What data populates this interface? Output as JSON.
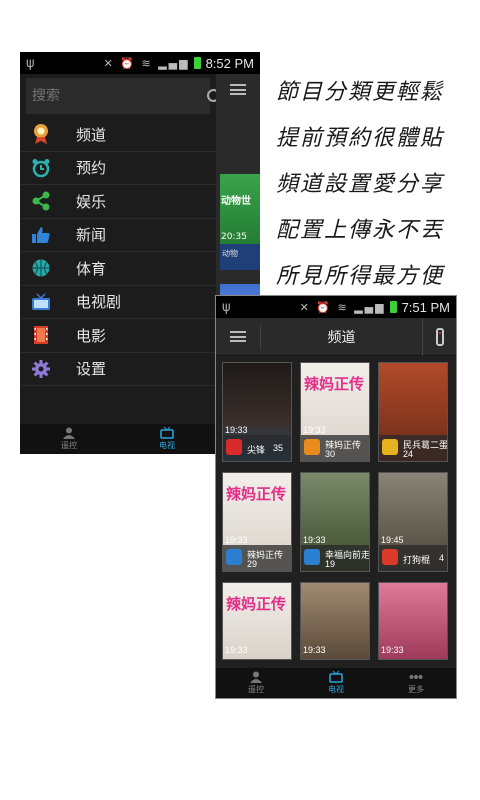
{
  "left_phone": {
    "status_time": "8:52 PM",
    "search": {
      "placeholder": "搜索"
    },
    "menu": [
      {
        "label": "频道",
        "icon": "channel-medal-icon",
        "color": "#e8a23a"
      },
      {
        "label": "预约",
        "icon": "alarm-clock-icon",
        "color": "#2bb3b3"
      },
      {
        "label": "娱乐",
        "icon": "share-icon",
        "color": "#3cb84a"
      },
      {
        "label": "新闻",
        "icon": "thumbs-up-icon",
        "color": "#2f86d9"
      },
      {
        "label": "体育",
        "icon": "basketball-icon",
        "color": "#2aa6a6"
      },
      {
        "label": "电视剧",
        "icon": "tv-icon",
        "color": "#3a7bd5"
      },
      {
        "label": "电影",
        "icon": "film-icon",
        "color": "#d93a2a"
      },
      {
        "label": "设置",
        "icon": "gear-icon",
        "color": "#8c7ad9"
      }
    ],
    "tabs": [
      {
        "label": "遥控",
        "icon": "person-icon"
      },
      {
        "label": "电视",
        "icon": "tv-icon"
      }
    ],
    "peek": {
      "thumb_title": "动物世",
      "thumb_time": "20:35",
      "thumb_caption": "动物"
    }
  },
  "slogans": [
    "節目分類更輕鬆",
    "提前預約很體貼",
    "頻道設置愛分享",
    "配置上傳永不丟",
    "所見所得最方便"
  ],
  "right_phone": {
    "status_time": "7:51 PM",
    "title": "频道",
    "cards": [
      {
        "time": "19:33",
        "program": "尖锋",
        "number": "35",
        "poster": "#3a2e2a",
        "logo": "#d92b2b",
        "title": ""
      },
      {
        "time": "19:33",
        "program": "辣妈正传",
        "number": "30",
        "poster": "#e7e2dc",
        "logo": "#e88a1e",
        "title": "辣妈正传"
      },
      {
        "time": "",
        "program": "民兵葛二蛋",
        "number": "24",
        "poster": "#8a3a22",
        "logo": "#e6b21e",
        "title": ""
      },
      {
        "time": "19:33",
        "program": "辣妈正传",
        "number": "29",
        "poster": "#e7e2dc",
        "logo": "#2a7fd1",
        "title": "辣妈正传"
      },
      {
        "time": "19:33",
        "program": "幸福向前走",
        "number": "19",
        "poster": "#4a5a3a",
        "logo": "#2a7fd1",
        "title": ""
      },
      {
        "time": "19:45",
        "program": "打狗棍",
        "number": "4",
        "poster": "#5a5448",
        "logo": "#d93a2a",
        "title": ""
      },
      {
        "time": "19:33",
        "program": "",
        "number": "",
        "poster": "#e7e2dc",
        "logo": "",
        "title": "辣妈正传"
      },
      {
        "time": "19:33",
        "program": "",
        "number": "",
        "poster": "#6a5a4a",
        "logo": "",
        "title": ""
      },
      {
        "time": "19:33",
        "program": "",
        "number": "",
        "poster": "#c94c6a",
        "logo": "",
        "title": ""
      }
    ],
    "tabs": [
      {
        "label": "遥控",
        "icon": "person-icon"
      },
      {
        "label": "电视",
        "icon": "tv-icon"
      },
      {
        "label": "更多",
        "icon": "more-dots-icon"
      }
    ]
  }
}
